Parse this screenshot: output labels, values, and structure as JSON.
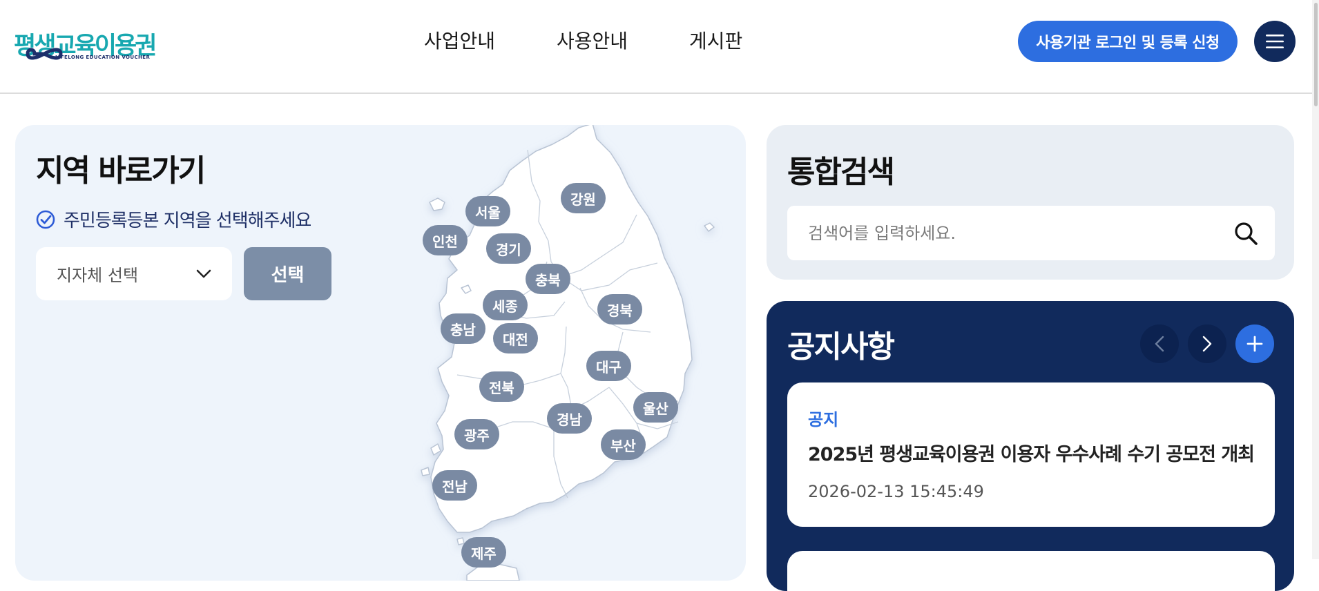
{
  "header": {
    "logo_text": "평생교육이용권",
    "logo_sub": "LIFELONG EDUCATION VOUCHER",
    "nav": [
      "사업안내",
      "사용안내",
      "게시판"
    ],
    "login_button": "사용기관 로그인 및 등록 신청",
    "menu_icon": "hamburger-icon"
  },
  "region": {
    "title": "지역 바로가기",
    "hint": "주민등록등본 지역을 선택해주세요",
    "select_value": "지자체 선택",
    "choose_button": "선택",
    "map_labels": {
      "seoul": "서울",
      "incheon": "인천",
      "gyeonggi": "경기",
      "gangwon": "강원",
      "chungbuk": "충북",
      "sejong": "세종",
      "chungnam": "충남",
      "daejeon": "대전",
      "gyeongbuk": "경북",
      "daegu": "대구",
      "jeonbuk": "전북",
      "ulsan": "울산",
      "gyeongnam": "경남",
      "gwangju": "광주",
      "busan": "부산",
      "jeonnam": "전남",
      "jeju": "제주"
    }
  },
  "search": {
    "title": "통합검색",
    "placeholder": "검색어를 입력하세요."
  },
  "notice": {
    "title": "공지사항",
    "item": {
      "category": "공지",
      "title": "2025년 평생교육이용권 이용자 우수사례 수기 공모전 개최",
      "date": "2026-02-13 15:45:49"
    }
  },
  "colors": {
    "accent": "#2d6ee0",
    "navy": "#112a5c",
    "pin": "#7a8aa3",
    "region_bg": "#eef4fb"
  }
}
